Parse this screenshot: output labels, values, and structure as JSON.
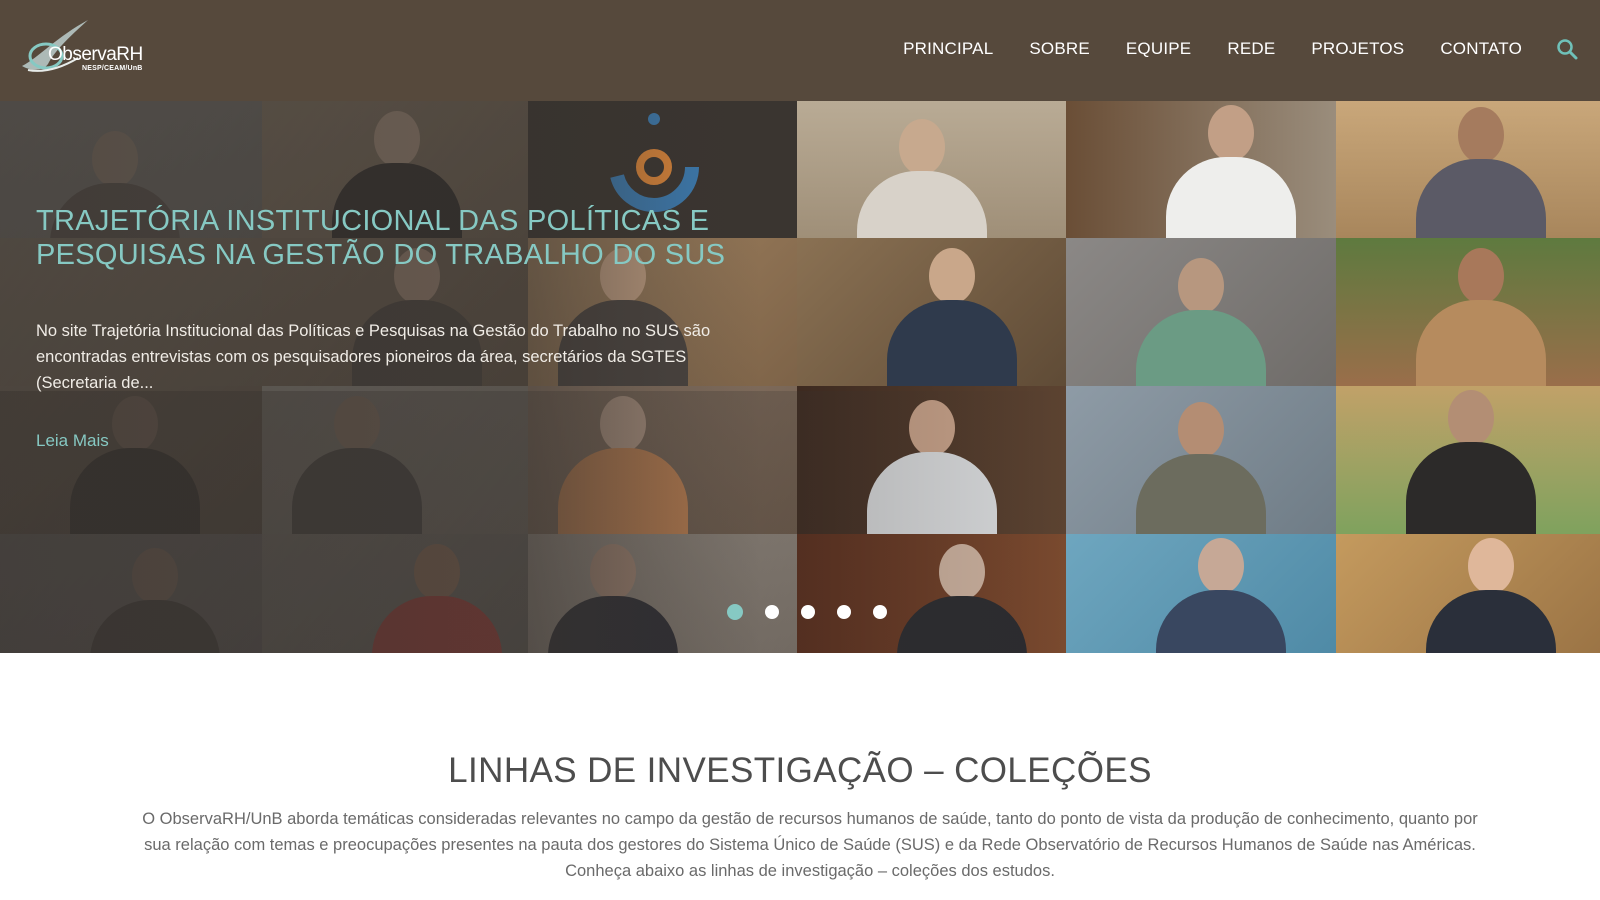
{
  "header": {
    "logo_name": "ObservaRH",
    "logo_sub": "NESP/CEAM/UnB",
    "nav": [
      "PRINCIPAL",
      "SOBRE",
      "EQUIPE",
      "REDE",
      "PROJETOS",
      "CONTATO"
    ],
    "search_icon": "search-icon"
  },
  "hero": {
    "title": "TRAJETÓRIA INSTITUCIONAL DAS POLÍTICAS E PESQUISAS NA GESTÃO DO TRABALHO DO SUS",
    "text": "No site Trajetória Institucional das Políticas e Pesquisas na Gestão do Trabalho no SUS são encontradas entrevistas com os pesquisadores pioneiros da área, secretários da SGTES (Secretaria de...",
    "read_more": "Leia Mais",
    "slides": 5,
    "active_slide": 1
  },
  "section": {
    "title": "LINHAS DE INVESTIGAÇÃO – COLEÇÕES",
    "text": "O ObservaRH/UnB aborda temáticas consideradas relevantes no campo da gestão de recursos humanos de saúde, tanto do ponto de vista da produção de conhecimento, quanto por sua relação com temas e preocupações presentes na pauta dos gestores do Sistema Único de Saúde (SUS) e da Rede Observatório de Recursos Humanos de Saúde nas Américas. Conheça abaixo as linhas de investigação – coleções dos estudos."
  },
  "colors": {
    "header_bg": "#56493c",
    "accent": "#86c9c3",
    "dot_active": "#86c9c3"
  }
}
